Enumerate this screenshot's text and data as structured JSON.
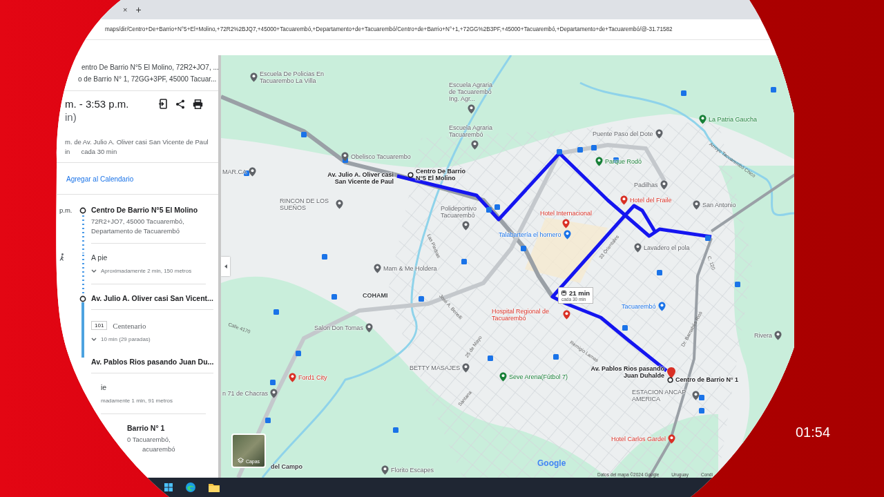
{
  "browser": {
    "tab_close": "×",
    "new_tab": "+",
    "url": "maps/dir/Centro+De+Barrio+N°5+El+Molino,+72R2%2BJQ7,+45000+Tacuarembó,+Departamento+de+Tacuarembó/Centro+de+Barrio+N°+1,+72GG%2B3PF,+45000+Tacuarembó,+Departamento+de+Tacuarembó/@-31.71582"
  },
  "sidebar": {
    "route_summary": [
      "entro De Barrio N°5 El Molino, 72R2+JO7, ...",
      "o de Barrio N° 1, 72GG+3PF, 45000 Tacuar..."
    ],
    "times": "m. - 3:53 p.m.",
    "duration": "in)",
    "departure": "m. de Av. Julio A. Oliver casi San Vicente de Paul",
    "frequency_prefix": "in",
    "frequency": "cada 30 min",
    "calendar_link": "Agregar al Calendario",
    "steps": [
      {
        "kind": "stop",
        "time": "p.m.",
        "title": "Centro De Barrio N°5 El Molino",
        "address_lines": [
          "72R2+JO7, 45000 Tacuarembó,",
          "Departamento de Tacuarembó"
        ]
      },
      {
        "kind": "walk",
        "title": "A pie",
        "detail": "Aproximadamente 2 min, 150 metros"
      },
      {
        "kind": "stop",
        "title": "Av. Julio A. Oliver casi San Vicent..."
      },
      {
        "kind": "bus",
        "route": "101",
        "title": "Centenario",
        "detail": "10 min (29 paradas)"
      },
      {
        "kind": "stop",
        "title": "Av. Pablos Rios pasando Juan Du..."
      },
      {
        "kind": "walk",
        "title": "ie",
        "detail": "madamente 1 min, 91 metros"
      },
      {
        "kind": "stop",
        "title": "Barrio N° 1",
        "address_lines": [
          "0 Tacuarembó,",
          "acuarembó"
        ]
      }
    ]
  },
  "map": {
    "labels": [
      {
        "text": "Escuela De Policias En Tacuarembo La Villa",
        "color": "#5f6368",
        "kind": "place"
      },
      {
        "text": "Escuela Agraria de Tacuarembó Ing. Agr...",
        "color": "#5f6368",
        "kind": "place"
      },
      {
        "text": "La Patria Gaucha",
        "color": "#188038",
        "kind": "place"
      },
      {
        "text": "Escuela Agraria Tacuarembó",
        "color": "#5f6368",
        "kind": "place"
      },
      {
        "text": "Puente Paso del Dote",
        "color": "#5f6368",
        "kind": "place"
      },
      {
        "text": "Obelisco Tacuarembo",
        "color": "#5f6368",
        "kind": "place"
      },
      {
        "text": "Parque Rodó",
        "color": "#188038",
        "kind": "place"
      },
      {
        "text": "MAR.CA",
        "color": "#5f6368",
        "kind": "place"
      },
      {
        "text": "Centro De Barrio N°5 El Molino",
        "kind": "endpoint"
      },
      {
        "text": "Av. Julio A. Oliver casi San Vicente de Paul",
        "kind": "stop"
      },
      {
        "text": "Padilhas",
        "color": "#5f6368",
        "kind": "place"
      },
      {
        "text": "Hotel del Fraile",
        "color": "#d93025",
        "kind": "place"
      },
      {
        "text": "RINCON DE LOS SUEÑOS",
        "color": "#5f6368",
        "kind": "place"
      },
      {
        "text": "San Antonio",
        "color": "#5f6368",
        "kind": "place"
      },
      {
        "text": "Polideportivo Tacuarembó",
        "color": "#5f6368",
        "kind": "place"
      },
      {
        "text": "Hotel Internacional",
        "color": "#d93025",
        "kind": "place"
      },
      {
        "text": "Talabartería el hornero",
        "color": "#1a73e8",
        "kind": "place"
      },
      {
        "text": "Lavadero el pola",
        "color": "#5f6368",
        "kind": "place"
      },
      {
        "text": "Mam & Me Holdera",
        "color": "#5f6368",
        "kind": "place"
      },
      {
        "text": "COHAMI",
        "kind": "area"
      },
      {
        "text": "Tacuarembó",
        "color": "#1a73e8",
        "kind": "place"
      },
      {
        "text": "Hospital Regional de Tacuarembó",
        "color": "#d93025",
        "kind": "place"
      },
      {
        "text": "Salon Don Tomas",
        "color": "#5f6368",
        "kind": "place"
      },
      {
        "text": "Rivera",
        "color": "#5f6368",
        "kind": "place"
      },
      {
        "text": "BETTY MASAJES",
        "color": "#5f6368",
        "kind": "place"
      },
      {
        "text": "Av. Pablos Rios pasando Juan Duhalde",
        "kind": "stop"
      },
      {
        "text": "Ford1 City",
        "color": "#d93025",
        "kind": "place"
      },
      {
        "text": "Seve Arena(Fútbol 7)",
        "color": "#188038",
        "kind": "place"
      },
      {
        "text": "Centro de Barrio N° 1",
        "kind": "endpoint"
      },
      {
        "text": "n 71 de Chacras",
        "color": "#5f6368",
        "kind": "place"
      },
      {
        "text": "ESTACION ANCAP AMERICA",
        "color": "#5f6368",
        "kind": "place"
      },
      {
        "text": "Hotel Carlos Gardel",
        "color": "#d93025",
        "kind": "place"
      },
      {
        "text": "del Campo",
        "kind": "area"
      },
      {
        "text": "Florito Escapes",
        "color": "#5f6368",
        "kind": "place"
      }
    ],
    "streets": [
      "Arroyo Tacuarembó Chico",
      "Las Piedras",
      "33 Orientales",
      "C. 120",
      "José A. Benelli",
      "Calle 4170",
      "Dr. Barnabés Rios",
      "25 de Mayo",
      "Remigio Lamas",
      "Santana"
    ],
    "duration_bubble": {
      "time": "21 min",
      "frequency": "cada 30 min"
    },
    "layers_button": "Capas",
    "logo": "Google",
    "footer": [
      "Datos del mapa ©2024 Google",
      "Uruguay",
      "Condi"
    ]
  },
  "broadcast_clock": "01:54"
}
